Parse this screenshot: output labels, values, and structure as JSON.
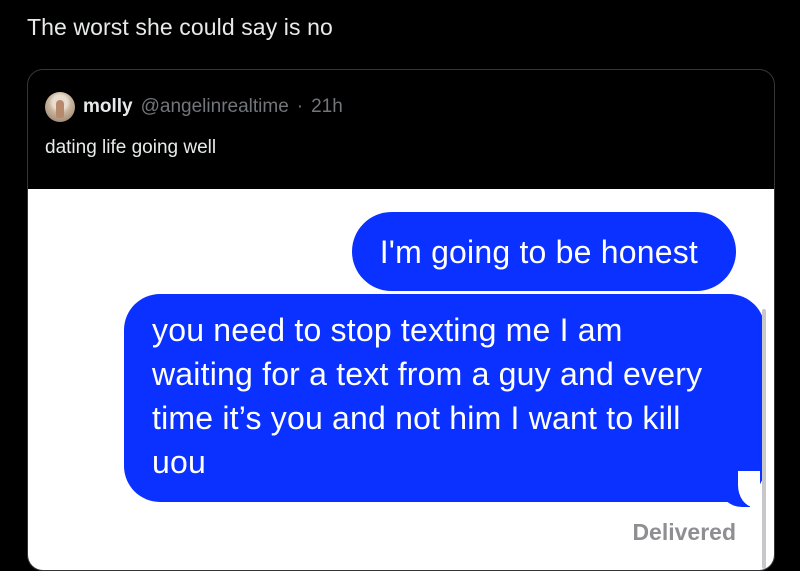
{
  "post": {
    "text": "The worst she could say is no"
  },
  "quoted": {
    "display_name": "molly",
    "handle": "@angelinrealtime",
    "separator": "·",
    "time": "21h",
    "text": "dating life going well",
    "avatar_icon": "profile-photo"
  },
  "messages": [
    {
      "text": "I'm going to be honest"
    },
    {
      "text": "you need to stop texting me I am waiting for a text from a guy and every time it’s you and not him I want to kill uou"
    }
  ],
  "status": "Delivered",
  "colors": {
    "bubble": "#0a31ff",
    "background": "#000000",
    "muted": "#71767b"
  }
}
